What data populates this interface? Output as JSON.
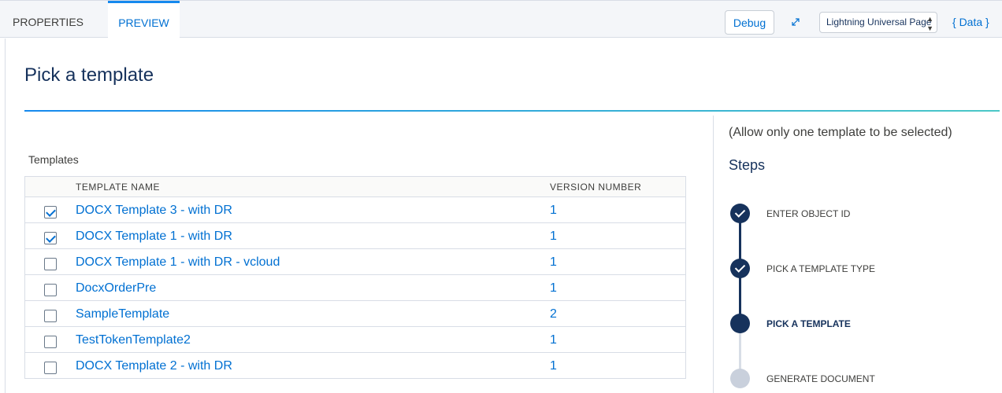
{
  "tabs": [
    {
      "label": "PROPERTIES"
    },
    {
      "label": "PREVIEW"
    }
  ],
  "toolbar": {
    "debug_label": "Debug",
    "page_type_value": "Lightning Universal Page",
    "data_label": "{ Data }"
  },
  "page": {
    "title": "Pick a template"
  },
  "templates": {
    "label": "Templates",
    "columns": [
      "TEMPLATE NAME",
      "VERSION NUMBER"
    ],
    "rows": [
      {
        "name": "DOCX Template 3 - with DR",
        "version": "1",
        "checked": true
      },
      {
        "name": "DOCX Template 1 - with DR",
        "version": "1",
        "checked": true
      },
      {
        "name": "DOCX Template 1 - with DR - vcloud",
        "version": "1",
        "checked": false
      },
      {
        "name": "DocxOrderPre",
        "version": "1",
        "checked": false
      },
      {
        "name": "SampleTemplate",
        "version": "2",
        "checked": false
      },
      {
        "name": "TestTokenTemplate2",
        "version": "1",
        "checked": false
      },
      {
        "name": "DOCX Template 2 - with DR",
        "version": "1",
        "checked": false
      }
    ]
  },
  "steps": {
    "hint": "(Allow only one template to be selected)",
    "title": "Steps",
    "items": [
      {
        "label": "ENTER OBJECT ID",
        "state": "done"
      },
      {
        "label": "PICK A TEMPLATE TYPE",
        "state": "done"
      },
      {
        "label": "PICK A TEMPLATE",
        "state": "current"
      },
      {
        "label": "GENERATE DOCUMENT",
        "state": "todo"
      }
    ]
  },
  "colors": {
    "accent": "#0070d2",
    "navy": "#16325c",
    "border": "#d8dde6"
  },
  "icons": [
    "expand-icon",
    "select-arrows-icon",
    "check-icon"
  ]
}
